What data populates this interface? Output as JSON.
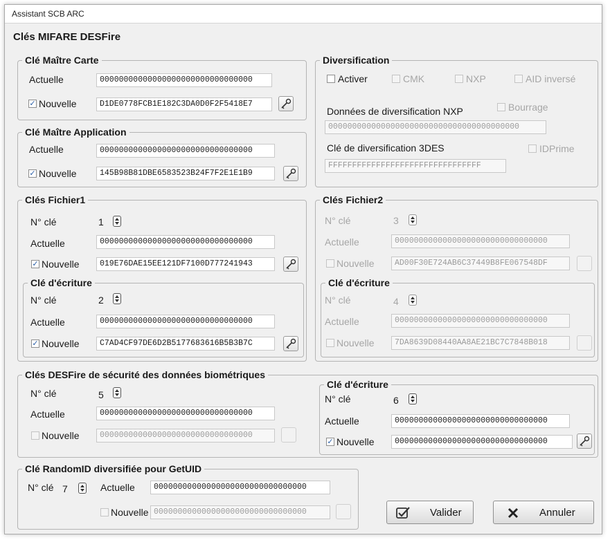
{
  "window": {
    "title": "Assistant SCB ARC"
  },
  "page_title": "Clés MIFARE DESFire",
  "labels": {
    "actuelle": "Actuelle",
    "nouvelle": "Nouvelle",
    "no_cle": "N° clé"
  },
  "cle_maitre_carte": {
    "title": "Clé Maître Carte",
    "actuelle": "00000000000000000000000000000000",
    "nouvelle": "D1DE0778FCB1E182C3DA0D0F2F5418E7",
    "nouvelle_checked": true
  },
  "cle_maitre_application": {
    "title": "Clé Maître Application",
    "actuelle": "00000000000000000000000000000000",
    "nouvelle": "145B98B81DBE6583523B24F7F2E1E1B9",
    "nouvelle_checked": true
  },
  "diversification": {
    "title": "Diversification",
    "activer": "Activer",
    "cmk": "CMK",
    "nxp": "NXP",
    "aid_inverse": "AID inversé",
    "donnees_label": "Données de diversification NXP",
    "bourrage": "Bourrage",
    "donnees_value": "0000000000000000000000000000000000000000",
    "cle_label": "Clé de diversification 3DES",
    "idprime": "IDPrime",
    "cle_value": "FFFFFFFFFFFFFFFFFFFFFFFFFFFFFFFF"
  },
  "fichier1": {
    "title": "Clés Fichier1",
    "no_cle": "1",
    "actuelle": "00000000000000000000000000000000",
    "nouvelle": "019E76DAE15EE121DF7100D777241943",
    "ecriture": {
      "title": "Clé d'écriture",
      "no_cle": "2",
      "actuelle": "00000000000000000000000000000000",
      "nouvelle": "C7AD4CF97DE6D2B5177683616B5B3B7C"
    }
  },
  "fichier2": {
    "title": "Clés Fichier2",
    "no_cle": "3",
    "actuelle": "00000000000000000000000000000000",
    "nouvelle": "AD00F30E724AB6C37449B8FE067548DF",
    "ecriture": {
      "title": "Clé d'écriture",
      "no_cle": "4",
      "actuelle": "00000000000000000000000000000000",
      "nouvelle": "7DA8639D08440AA8AE21BC7C7848B018"
    }
  },
  "biometrie": {
    "title": "Clés DESFire de sécurité des données biométriques",
    "no_cle": "5",
    "actuelle": "00000000000000000000000000000000",
    "nouvelle": "00000000000000000000000000000000",
    "ecriture": {
      "title": "Clé d'écriture",
      "no_cle": "6",
      "actuelle": "00000000000000000000000000000000",
      "nouvelle": "00000000000000000000000000000000"
    }
  },
  "randomid": {
    "title": "Clé RandomID diversifiée pour GetUID",
    "no_cle": "7",
    "actuelle": "00000000000000000000000000000000",
    "nouvelle": "00000000000000000000000000000000"
  },
  "buttons": {
    "valider": "Valider",
    "annuler": "Annuler"
  }
}
